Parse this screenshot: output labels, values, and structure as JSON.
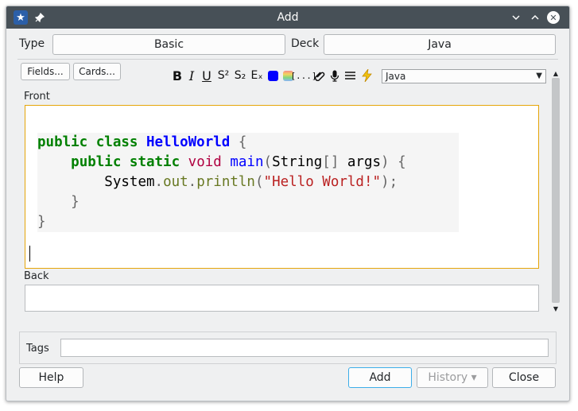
{
  "window": {
    "title": "Add",
    "title_icons": [
      "star-icon",
      "pin-icon"
    ],
    "controls": [
      "minimize-icon",
      "maximize-icon",
      "close-icon"
    ]
  },
  "top_row": {
    "type_label": "Type",
    "type_value": "Basic",
    "deck_label": "Deck",
    "deck_value": "Java"
  },
  "toolbar": {
    "fields_button": "Fields...",
    "cards_button": "Cards...",
    "bold": "B",
    "italic": "I",
    "underline": "U",
    "superscript": "S²",
    "subscript": "S₂",
    "clear_format": "Eₓ",
    "cloze": "[...]",
    "language_select": "Java",
    "text_color": "#0000ff"
  },
  "fields": {
    "front_label": "Front",
    "front_code": [
      [
        {
          "t": "public class ",
          "c": "kw"
        },
        {
          "t": "HelloWorld",
          "c": "cls"
        },
        {
          "t": " {",
          "c": "pn"
        }
      ],
      [
        {
          "t": "    ",
          "c": "plain"
        },
        {
          "t": "public static ",
          "c": "kw"
        },
        {
          "t": "void ",
          "c": "typ"
        },
        {
          "t": "main",
          "c": "fn"
        },
        {
          "t": "(",
          "c": "pn"
        },
        {
          "t": "String",
          "c": "plain"
        },
        {
          "t": "[] ",
          "c": "pn"
        },
        {
          "t": "args",
          "c": "plain"
        },
        {
          "t": ") {",
          "c": "pn"
        }
      ],
      [
        {
          "t": "        ",
          "c": "plain"
        },
        {
          "t": "System",
          "c": "plain"
        },
        {
          "t": ".",
          "c": "pn"
        },
        {
          "t": "out",
          "c": "attr"
        },
        {
          "t": ".",
          "c": "pn"
        },
        {
          "t": "println",
          "c": "attr"
        },
        {
          "t": "(",
          "c": "pn"
        },
        {
          "t": "\"Hello World!\"",
          "c": "str"
        },
        {
          "t": ");",
          "c": "pn"
        }
      ],
      [
        {
          "t": "    }",
          "c": "pn"
        }
      ],
      [
        {
          "t": "}",
          "c": "pn"
        }
      ]
    ],
    "back_label": "Back",
    "back_value": ""
  },
  "tags": {
    "label": "Tags",
    "value": ""
  },
  "buttons": {
    "help": "Help",
    "add": "Add",
    "history": "History ▾",
    "close": "Close"
  },
  "colors": {
    "titlebar": "#475057",
    "focus_border": "#e5a50a",
    "accent": "#3daee9"
  }
}
